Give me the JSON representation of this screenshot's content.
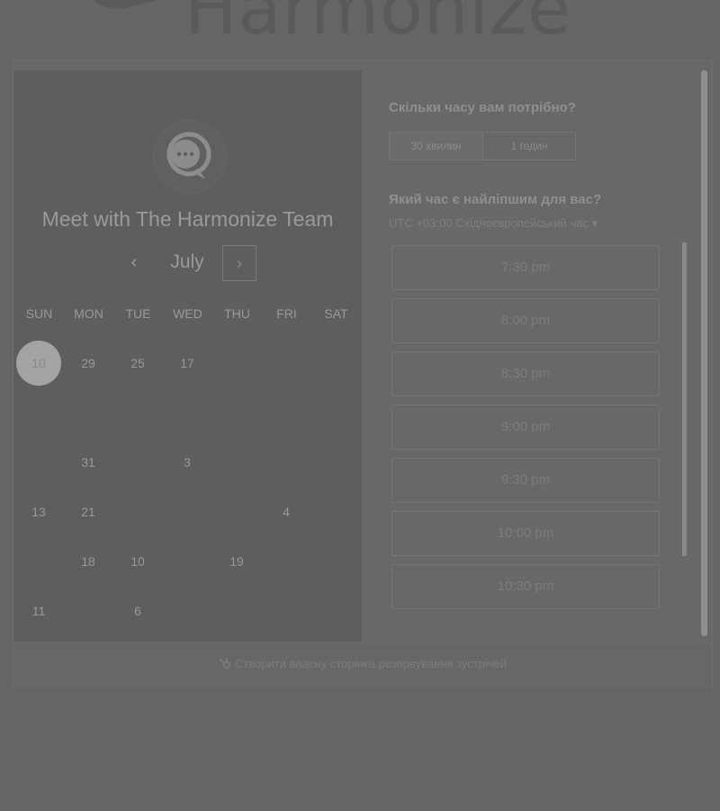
{
  "brand": {
    "name": "Harmonize"
  },
  "booking": {
    "title": "Meet with The Harmonize Team",
    "calendar": {
      "month": "July",
      "prev_symbol": "‹",
      "next_symbol": "›",
      "weekdays": [
        "SUN",
        "MON",
        "TUE",
        "WED",
        "THU",
        "FRI",
        "SAT"
      ],
      "dates": [
        {
          "label": "10",
          "row": 0,
          "col": 0,
          "selected": true
        },
        {
          "label": "29",
          "row": 0,
          "col": 1
        },
        {
          "label": "25",
          "row": 0,
          "col": 2
        },
        {
          "label": "17",
          "row": 0,
          "col": 3
        },
        {
          "label": "31",
          "row": 2,
          "col": 1
        },
        {
          "label": "3",
          "row": 2,
          "col": 3
        },
        {
          "label": "13",
          "row": 3,
          "col": 0
        },
        {
          "label": "21",
          "row": 3,
          "col": 1
        },
        {
          "label": "4",
          "row": 3,
          "col": 5
        },
        {
          "label": "18",
          "row": 4,
          "col": 1
        },
        {
          "label": "10",
          "row": 4,
          "col": 2
        },
        {
          "label": "19",
          "row": 4,
          "col": 4
        },
        {
          "label": "11",
          "row": 5,
          "col": 0
        },
        {
          "label": "6",
          "row": 5,
          "col": 2
        }
      ]
    },
    "duration_question": "Скільки часу вам потрібно?",
    "duration_options": [
      "30 хвилин",
      "1 годин"
    ],
    "time_question": "Який час є найліпшим для вас?",
    "timezone": "UTC +03:00 Східноєвропейський час",
    "timezone_caret": "▾",
    "time_slots": [
      "7:30 pm",
      "8:00 pm",
      "8:30 pm",
      "9:00 pm",
      "9:30 pm",
      "10:00 pm",
      "10:30 pm"
    ],
    "footer_link": "Створити власну сторінка резервування зустрічей"
  }
}
